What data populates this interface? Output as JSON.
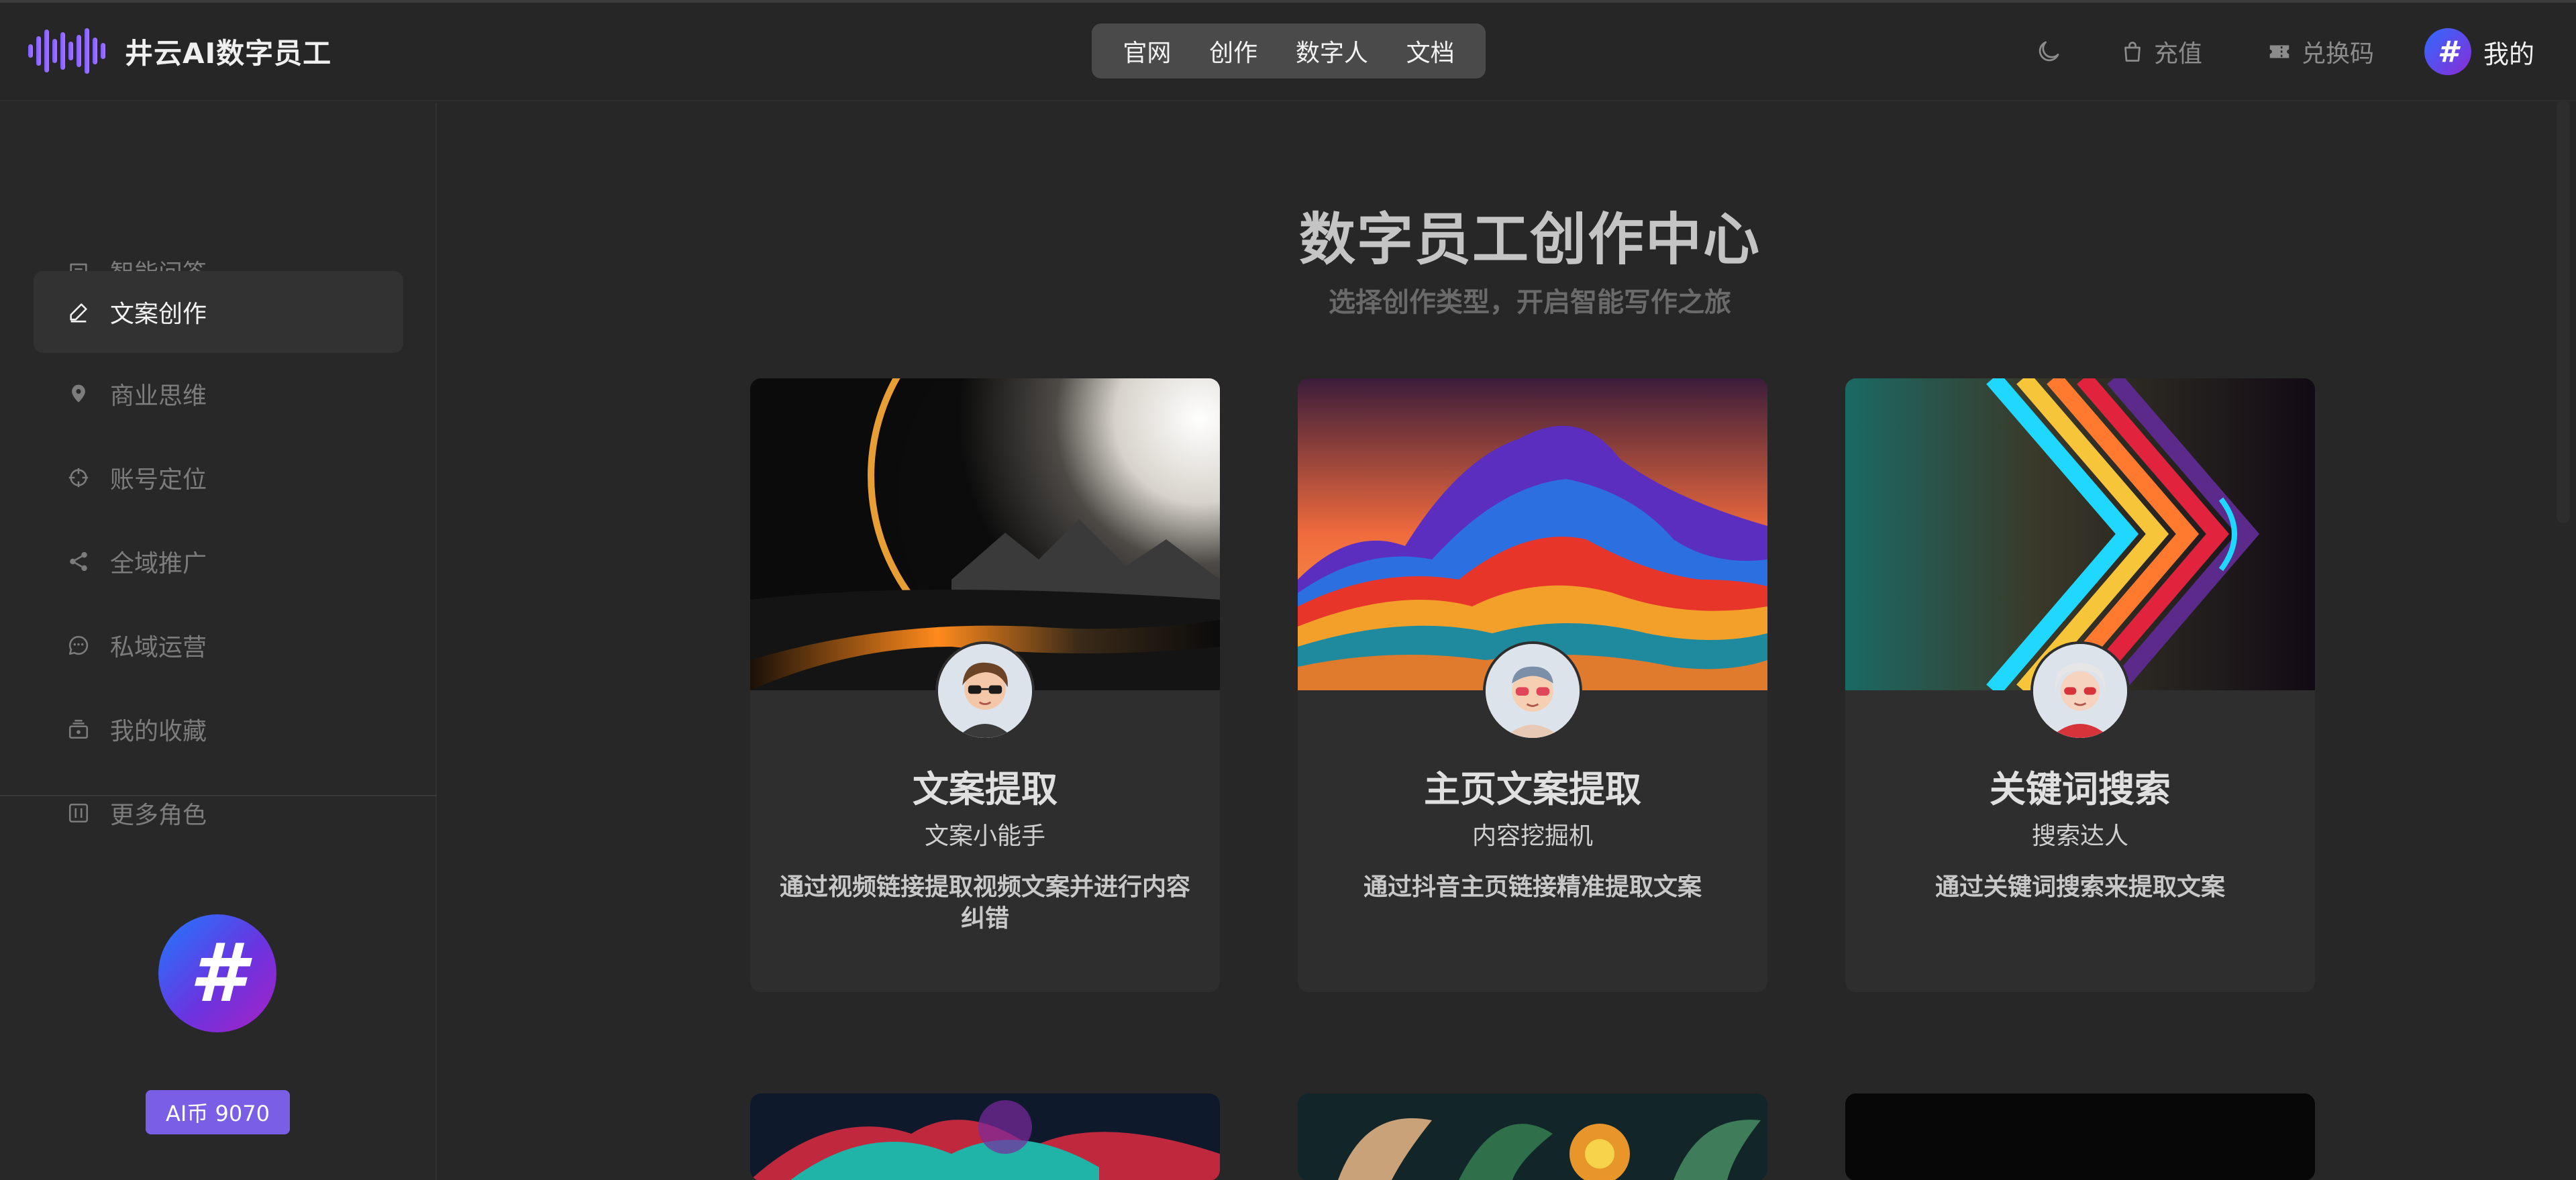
{
  "brand": {
    "name": "井云AI数字员工",
    "accent": "#8a6cff"
  },
  "nav": {
    "items": [
      "官网",
      "创作",
      "数字人",
      "文档"
    ]
  },
  "header": {
    "recharge": "充值",
    "redeem": "兑换码",
    "mine": "我的"
  },
  "sidebar": {
    "items": [
      {
        "label": "智能问答",
        "icon": "chat-square-icon",
        "active": false
      },
      {
        "label": "文案创作",
        "icon": "pen-icon",
        "active": true
      },
      {
        "label": "商业思维",
        "icon": "pin-icon",
        "active": false
      },
      {
        "label": "账号定位",
        "icon": "target-icon",
        "active": false
      },
      {
        "label": "全域推广",
        "icon": "share-icon",
        "active": false
      },
      {
        "label": "私域运营",
        "icon": "message-circle-icon",
        "active": false
      },
      {
        "label": "我的收藏",
        "icon": "collection-icon",
        "active": false
      },
      {
        "label": "更多角色",
        "icon": "grid-box-icon",
        "active": false
      }
    ],
    "coin_badge": "AI币 9070",
    "badge_color": "#7a5fe6"
  },
  "main": {
    "title": "数字员工创作中心",
    "subtitle": "选择创作类型，开启智能写作之旅",
    "cards": [
      {
        "title": "文案提取",
        "role": "文案小能手",
        "desc": "通过视频链接提取视频文案并进行内容纠错"
      },
      {
        "title": "主页文案提取",
        "role": "内容挖掘机",
        "desc": "通过抖音主页链接精准提取文案"
      },
      {
        "title": "关键词搜索",
        "role": "搜索达人",
        "desc": "通过关键词搜索来提取文案"
      }
    ]
  }
}
